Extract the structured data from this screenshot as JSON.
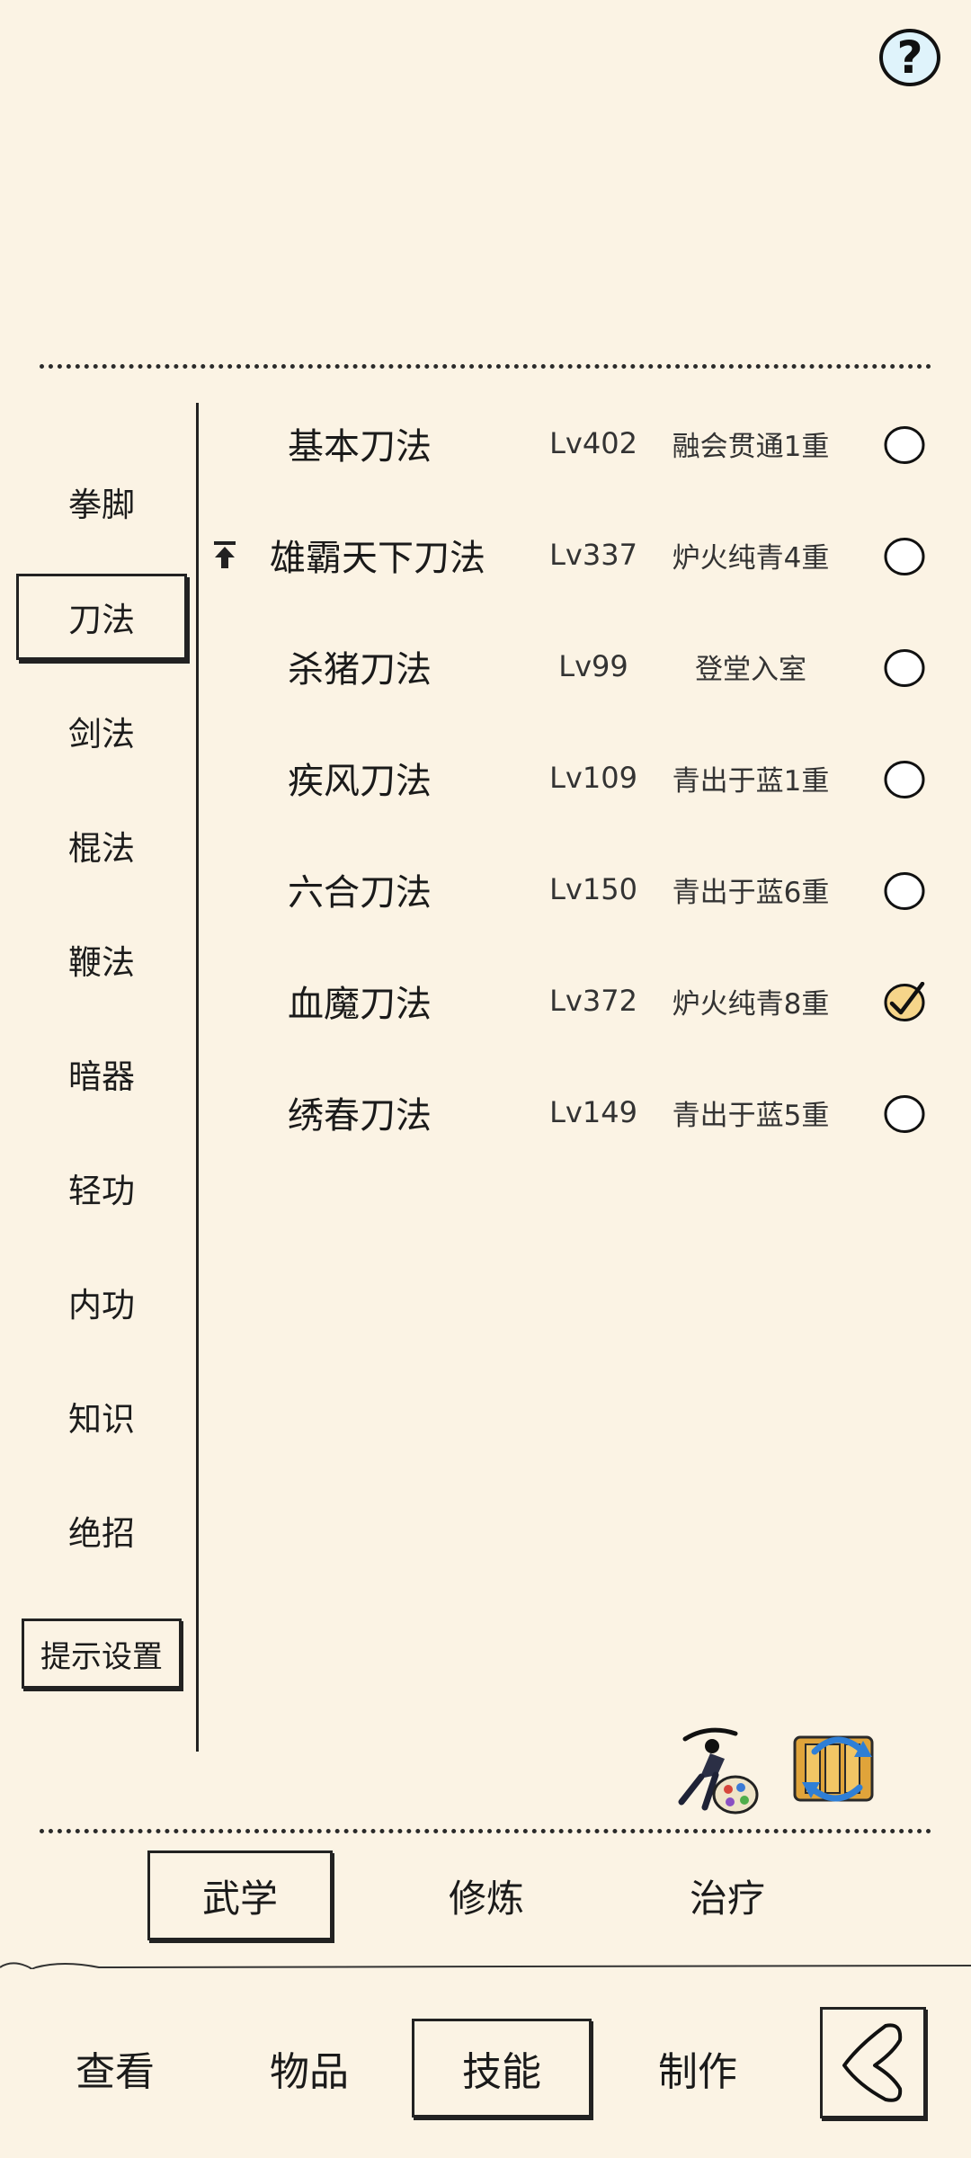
{
  "help": {
    "label": "?"
  },
  "categories": [
    {
      "label": "拳脚",
      "active": false
    },
    {
      "label": "刀法",
      "active": true
    },
    {
      "label": "剑法",
      "active": false
    },
    {
      "label": "棍法",
      "active": false
    },
    {
      "label": "鞭法",
      "active": false
    },
    {
      "label": "暗器",
      "active": false
    },
    {
      "label": "轻功",
      "active": false
    },
    {
      "label": "内功",
      "active": false
    },
    {
      "label": "知识",
      "active": false
    },
    {
      "label": "绝招",
      "active": false
    }
  ],
  "tip_settings_label": "提示设置",
  "skills": [
    {
      "name": "基本刀法",
      "level": "Lv402",
      "rank": "融会贯通1重",
      "checked": false,
      "upgrade": false
    },
    {
      "name": "雄霸天下刀法",
      "level": "Lv337",
      "rank": "炉火纯青4重",
      "checked": false,
      "upgrade": true
    },
    {
      "name": "杀猪刀法",
      "level": "Lv99",
      "rank": "登堂入室",
      "checked": false,
      "upgrade": false
    },
    {
      "name": "疾风刀法",
      "level": "Lv109",
      "rank": "青出于蓝1重",
      "checked": false,
      "upgrade": false
    },
    {
      "name": "六合刀法",
      "level": "Lv150",
      "rank": "青出于蓝6重",
      "checked": false,
      "upgrade": false
    },
    {
      "name": "血魔刀法",
      "level": "Lv372",
      "rank": "炉火纯青8重",
      "checked": true,
      "upgrade": false
    },
    {
      "name": "绣春刀法",
      "level": "Lv149",
      "rank": "青出于蓝5重",
      "checked": false,
      "upgrade": false
    }
  ],
  "sub_tabs": [
    {
      "label": "武学",
      "active": true
    },
    {
      "label": "修炼",
      "active": false
    },
    {
      "label": "治疗",
      "active": false
    }
  ],
  "bottom_nav": [
    {
      "label": "查看",
      "active": false
    },
    {
      "label": "物品",
      "active": false
    },
    {
      "label": "技能",
      "active": true
    },
    {
      "label": "制作",
      "active": false
    }
  ],
  "icons": {
    "help": "question-mark-icon",
    "upgrade": "arrow-up-icon",
    "martial_artist": "martial-artist-palette-icon",
    "scroll_swap": "scroll-swap-icon",
    "back": "back-arrow-icon"
  },
  "colors": {
    "background": "#fbf3e4",
    "ink": "#1a1a1a",
    "help_bg": "#dff3fb",
    "check_fill": "#f6d58a"
  }
}
